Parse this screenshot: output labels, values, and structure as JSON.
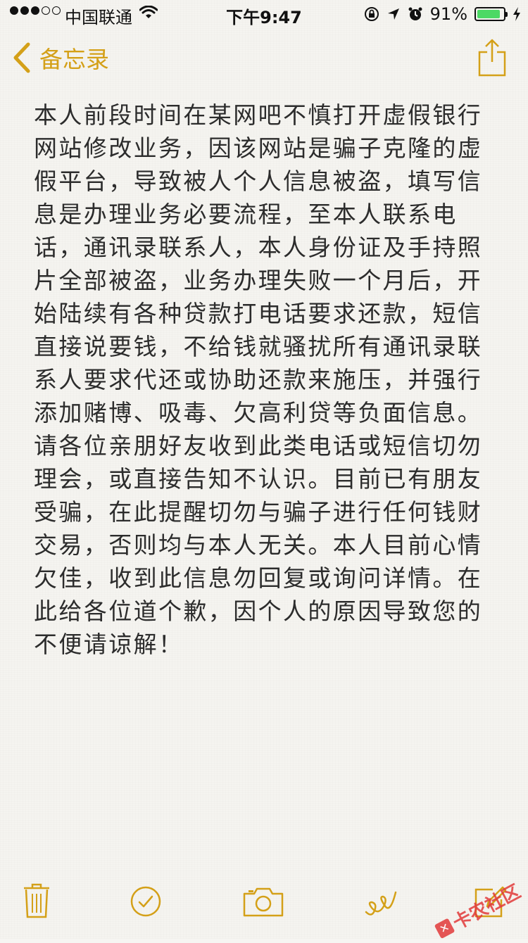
{
  "status_bar": {
    "carrier": "中国联通",
    "time": "下午9:47",
    "battery_percent": "91%",
    "battery_level": 0.91,
    "signal_strength": 3,
    "signal_total": 5
  },
  "nav": {
    "back_label": "备忘录"
  },
  "note": {
    "text": "本人前段时间在某网吧不慎打开虚假银行网站修改业务，因该网站是骗子克隆的虚假平台，导致被人个人信息被盗，填写信息是办理业务必要流程，至本人联系电话，通讯录联系人，本人身份证及手持照片全部被盗，业务办理失败一个月后，开始陆续有各种贷款打电话要求还款，短信直接说要钱，不给钱就骚扰所有通讯录联系人要求代还或协助还款来施压，并强行添加赌博、吸毒、欠高利贷等负面信息。请各位亲朋好友收到此类电话或短信切勿理会，或直接告知不认识。目前已有朋友受骗，在此提醒切勿与骗子进行任何钱财交易，否则均与本人无关。本人目前心情欠佳，收到此信息勿回复或询问详情。在此给各位道个歉，因个人的原因导致您的不便请谅解！"
  },
  "toolbar": {
    "icons": [
      "trash-icon",
      "checklist-icon",
      "camera-icon",
      "sketch-icon",
      "compose-icon"
    ]
  },
  "watermark": {
    "text": "卡农社区"
  },
  "colors": {
    "accent": "#d4a018",
    "battery": "#4cd964",
    "watermark": "#e23a3a"
  }
}
